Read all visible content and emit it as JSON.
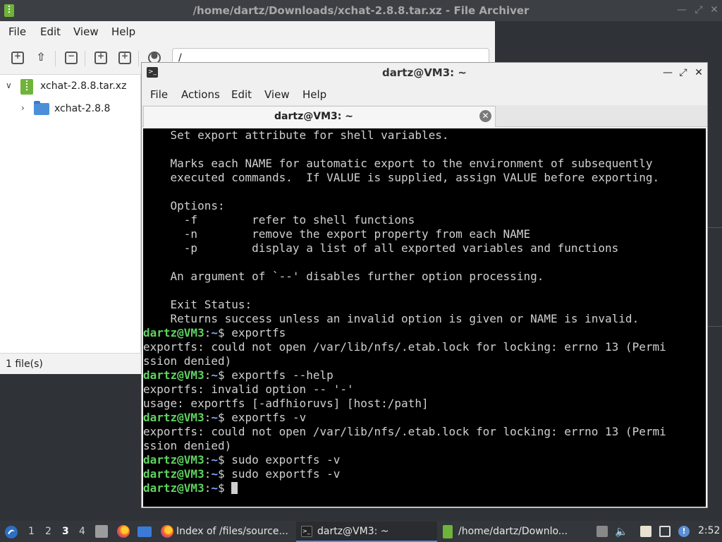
{
  "archiver": {
    "title": "/home/dartz/Downloads/xchat-2.8.8.tar.xz - File Archiver",
    "menu": [
      "File",
      "Edit",
      "View",
      "Help"
    ],
    "location": "/",
    "tree": [
      {
        "label": "xchat-2.8.8.tar.xz",
        "icon": "archive-icon"
      },
      {
        "label": "xchat-2.8.8",
        "icon": "folder-icon"
      }
    ],
    "status": "1 file(s)"
  },
  "terminal": {
    "title": "dartz@VM3: ~",
    "menu": [
      "File",
      "Actions",
      "Edit",
      "View",
      "Help"
    ],
    "tab_label": "dartz@VM3: ~",
    "prompt_user": "dartz@VM3",
    "prompt_path": "~",
    "lines": [
      {
        "text": "    Set export attribute for shell variables."
      },
      {
        "text": ""
      },
      {
        "text": "    Marks each NAME for automatic export to the environment of subsequently"
      },
      {
        "text": "    executed commands.  If VALUE is supplied, assign VALUE before exporting."
      },
      {
        "text": ""
      },
      {
        "text": "    Options:"
      },
      {
        "text": "      -f        refer to shell functions"
      },
      {
        "text": "      -n        remove the export property from each NAME"
      },
      {
        "text": "      -p        display a list of all exported variables and functions"
      },
      {
        "text": ""
      },
      {
        "text": "    An argument of `--' disables further option processing."
      },
      {
        "text": ""
      },
      {
        "text": "    Exit Status:"
      },
      {
        "text": "    Returns success unless an invalid option is given or NAME is invalid."
      },
      {
        "prompt": true,
        "cmd": "exportfs"
      },
      {
        "text": "exportfs: could not open /var/lib/nfs/.etab.lock for locking: errno 13 (Permi"
      },
      {
        "text": "ssion denied)"
      },
      {
        "prompt": true,
        "cmd": "exportfs --help"
      },
      {
        "text": "exportfs: invalid option -- '-'"
      },
      {
        "text": "usage: exportfs [-adfhioruvs] [host:/path]"
      },
      {
        "prompt": true,
        "cmd": "exportfs -v"
      },
      {
        "text": "exportfs: could not open /var/lib/nfs/.etab.lock for locking: errno 13 (Permi"
      },
      {
        "text": "ssion denied)"
      },
      {
        "prompt": true,
        "cmd": "sudo exportfs -v"
      },
      {
        "prompt": true,
        "cmd": "sudo exportfs -v"
      },
      {
        "prompt": true,
        "cmd": "",
        "cursor": true
      }
    ]
  },
  "taskbar": {
    "workspaces": [
      "1",
      "2",
      "3",
      "4"
    ],
    "active_workspace": "3",
    "tasks": [
      {
        "label": "Index of /files/source...",
        "icon": "firefox-icon"
      },
      {
        "label": "dartz@VM3: ~",
        "icon": "terminal-icon",
        "active": true
      },
      {
        "label": "/home/dartz/Downlo...",
        "icon": "archive-icon"
      }
    ],
    "clock": "2:52"
  },
  "colors": {
    "prompt_user": "#5fd35f",
    "prompt_path": "#7ea7ff",
    "terminal_bg": "#000000",
    "terminal_fg": "#d0d0d0",
    "accent": "#4a90d9"
  }
}
